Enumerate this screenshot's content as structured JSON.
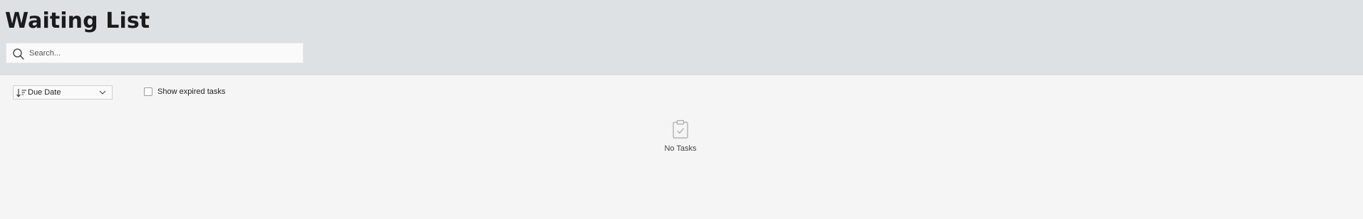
{
  "header": {
    "title": "Waiting List"
  },
  "search": {
    "placeholder": "Search...",
    "value": "",
    "icon": "search-icon"
  },
  "toolbar": {
    "sort": {
      "selected": "Due Date",
      "icon": "sort-descending-icon"
    },
    "show_expired": {
      "label": "Show expired tasks",
      "checked": false
    }
  },
  "empty_state": {
    "icon": "clipboard-check-icon",
    "message": "No Tasks"
  },
  "colors": {
    "header_background": "#dee1e3",
    "page_background": "#f5f5f5",
    "search_background": "#fafafa",
    "icon_muted": "#a8a8a8"
  }
}
